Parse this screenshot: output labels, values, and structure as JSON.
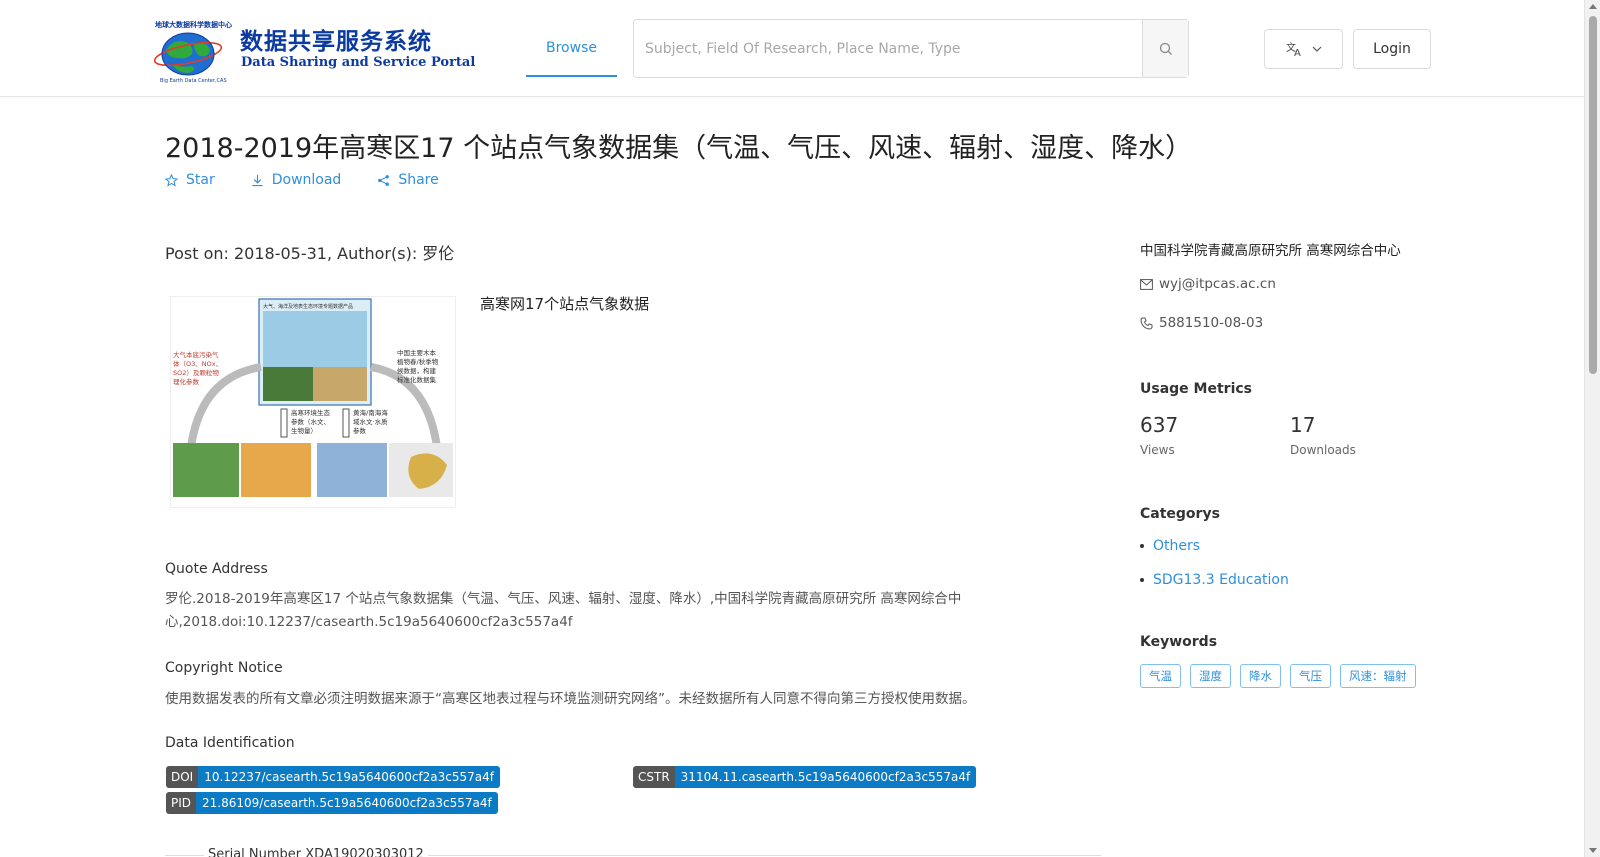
{
  "header": {
    "logo": {
      "cn_title": "数据共享服务系统",
      "en_title": "Data Sharing and Service Portal",
      "ring_text": "地球大数据科学数据中心",
      "foot_text": "Big Earth Data Center,CAS"
    },
    "nav": {
      "browse_label": "Browse"
    },
    "search": {
      "placeholder": "Subject, Field Of Research, Place Name, Type",
      "value": "",
      "icon": "search-icon"
    },
    "language": {
      "icon": "translate-icon"
    },
    "login_label": "Login"
  },
  "dataset": {
    "title": "2018-2019年高寒区17 个站点气象数据集（气温、气压、风速、辐射、湿度、降水）",
    "actions": [
      {
        "label": "Star",
        "icon": "star-icon"
      },
      {
        "label": "Download",
        "icon": "download-icon"
      },
      {
        "label": "Share",
        "icon": "share-icon"
      }
    ],
    "post_info": "Post on: 2018-05-31, Author(s): 罗伦",
    "abstract": "高寒网17个站点气象数据",
    "thumbnail": {
      "header": "大气、海洋及地表生态环境专题数据产品",
      "left_text": "大气本底污染气体（O3、NOx、SO2）及颗粒物理化参数",
      "right_text": "中国主要木本植物春/秋季物候数据，构建标准化数据集",
      "center_left": "高寒环境生态参数（水文、生物量）",
      "center_right": "黄海/南海海域水文·水质参数"
    },
    "quote": {
      "label": "Quote Address",
      "text": "罗伦.2018-2019年高寒区17 个站点气象数据集（气温、气压、风速、辐射、湿度、降水）,中国科学院青藏高原研究所 高寒网综合中心,2018.doi:10.12237/casearth.5c19a5640600cf2a3c557a4f"
    },
    "copyright": {
      "label": "Copyright Notice",
      "text": "使用数据发表的所有文章必须注明数据来源于“高寒区地表过程与环境监测研究网络”。未经数据所有人同意不得向第三方授权使用数据。"
    },
    "identification": {
      "label": "Data Identification",
      "doi_key": "DOI",
      "doi": "10.12237/casearth.5c19a5640600cf2a3c557a4f",
      "cstr_key": "CSTR",
      "cstr": "31104.11.casearth.5c19a5640600cf2a3c557a4f",
      "pid_key": "PID",
      "pid": "21.86109/casearth.5c19a5640600cf2a3c557a4f"
    },
    "serial_number": "Serial Number XDA19020303012"
  },
  "sidebar": {
    "organization": "中国科学院青藏高原研究所 高寒网综合中心",
    "email": "wyj@itpcas.ac.cn",
    "phone": "5881510-08-03",
    "usage_metrics": {
      "label": "Usage Metrics",
      "views": "637",
      "views_label": "Views",
      "downloads": "17",
      "downloads_label": "Downloads"
    },
    "categories": {
      "label": "Categorys",
      "items": [
        "Others",
        "SDG13.3 Education"
      ]
    },
    "keywords": {
      "label": "Keywords",
      "items": [
        "气温",
        "湿度",
        "降水",
        "气压",
        "风速：辐射"
      ]
    }
  },
  "colors": {
    "accent": "#2f8fdd",
    "badge_key": "#555555",
    "badge_value": "#0a7bc4",
    "logo_blue": "#0b3aa0"
  }
}
